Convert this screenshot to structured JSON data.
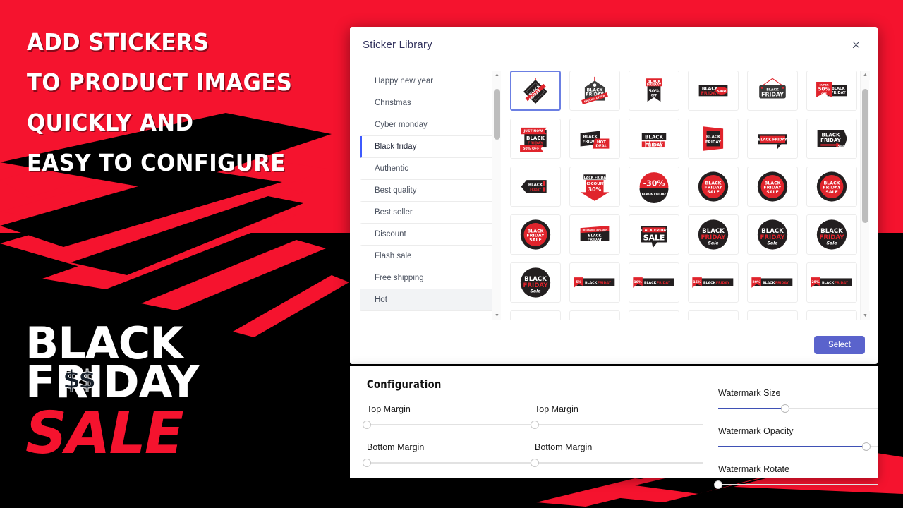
{
  "promo": {
    "headline_lines": [
      "Add Stickers",
      "to product images",
      "Quickly and",
      "Easy to configure"
    ],
    "logo": {
      "line1": "Black",
      "line2": "Friday",
      "dollars": "$$",
      "line3": "Sale"
    },
    "colors": {
      "red": "#f5132e",
      "black": "#000000",
      "white": "#ffffff"
    }
  },
  "modal": {
    "title": "Sticker Library",
    "close_icon": "close-icon",
    "categories": [
      {
        "label": "Happy new year",
        "state": "normal"
      },
      {
        "label": "Christmas",
        "state": "normal"
      },
      {
        "label": "Cyber monday",
        "state": "normal"
      },
      {
        "label": "Black friday",
        "state": "selected"
      },
      {
        "label": "Authentic",
        "state": "normal"
      },
      {
        "label": "Best quality",
        "state": "normal"
      },
      {
        "label": "Best seller",
        "state": "normal"
      },
      {
        "label": "Discount",
        "state": "normal"
      },
      {
        "label": "Flash sale",
        "state": "normal"
      },
      {
        "label": "Free shipping",
        "state": "normal"
      },
      {
        "label": "Hot",
        "state": "hovered"
      }
    ],
    "category_scrollbar": {
      "up_icon": "chevron-up-icon",
      "down_icon": "chevron-down-icon",
      "thumb_top_pct": 4,
      "thumb_height_pct": 22
    },
    "grid_scrollbar": {
      "up_icon": "chevron-up-icon",
      "down_icon": "chevron-down-icon",
      "thumb_top_pct": 4,
      "thumb_height_pct": 58
    },
    "stickers": [
      {
        "id": "s1",
        "type": "diamond-tag",
        "text": "BLACK FRIDAY",
        "sub": "SALE",
        "selected": true
      },
      {
        "id": "s2",
        "type": "price-tag",
        "text": "BLACK FRIDAY",
        "sub": "SPECIAL OFFER",
        "selected": false
      },
      {
        "id": "s3",
        "type": "ribbon-banner",
        "text": "BLACK FRIDAY",
        "sub": "50% OFF",
        "selected": false
      },
      {
        "id": "s4",
        "type": "bar-script",
        "text": "BLACK FRIDAY",
        "sub": "Sale",
        "selected": false
      },
      {
        "id": "s5",
        "type": "hanging-sign",
        "text": "BLACK FRIDAY",
        "sub": "",
        "selected": false
      },
      {
        "id": "s6",
        "type": "corner-percent",
        "text": "BLACK FRIDAY",
        "sub": "SUPER 50% OFF",
        "selected": false
      },
      {
        "id": "s7",
        "type": "justnow-banner",
        "text": "BLACK FRIDAY",
        "sub": "JUST NOW / 50% OFF",
        "selected": false
      },
      {
        "id": "s8",
        "type": "hot-deal",
        "text": "BLACK FRIDAY",
        "sub": "HOT DEAL",
        "selected": false
      },
      {
        "id": "s9",
        "type": "blocks-label",
        "text": "BLACK FRIDAY",
        "sub": "",
        "selected": false
      },
      {
        "id": "s10",
        "type": "folded-ribbon",
        "text": "BLACK FRIDAY",
        "sub": "",
        "selected": false
      },
      {
        "id": "s11",
        "type": "speech-bar",
        "text": "BLACK FRIDAY",
        "sub": "",
        "selected": false
      },
      {
        "id": "s12",
        "type": "arrow-tag",
        "text": "BLACK FRIDAY",
        "sub": "Sale!",
        "selected": false
      },
      {
        "id": "s13",
        "type": "left-arrow-tag",
        "text": "BLACK FRIDAY",
        "sub": "",
        "selected": false
      },
      {
        "id": "s14",
        "type": "down-arrow",
        "text": "BLACK FRIDAY",
        "sub": "DISCOUNT 30%",
        "selected": false
      },
      {
        "id": "s15",
        "type": "circle-percent",
        "text": "-30%",
        "sub": "BLACK FRIDAY",
        "selected": false
      },
      {
        "id": "s16",
        "type": "circle-red-1",
        "text": "BLACK FRIDAY SALE",
        "sub": "",
        "selected": false
      },
      {
        "id": "s17",
        "type": "circle-red-2",
        "text": "BLACK FRIDAY SALE",
        "sub": "",
        "selected": false
      },
      {
        "id": "s18",
        "type": "circle-red-3",
        "text": "BLACK FRIDAY SALE",
        "sub": "",
        "selected": false
      },
      {
        "id": "s19",
        "type": "circle-red-4",
        "text": "BLACK FRIDAY SALE",
        "sub": "",
        "selected": false
      },
      {
        "id": "s20",
        "type": "skew-label",
        "text": "BLACK FRIDAY",
        "sub": "DISCOUNT 30% OFF",
        "selected": false
      },
      {
        "id": "s21",
        "type": "speech-sale",
        "text": "BLACK FRIDAY",
        "sub": "SALE",
        "selected": false
      },
      {
        "id": "s22",
        "type": "circle-black-1",
        "text": "BLACK FRIDAY",
        "sub": "Sale",
        "selected": false
      },
      {
        "id": "s23",
        "type": "circle-black-2",
        "text": "BLACK FRIDAY",
        "sub": "Sale",
        "selected": false
      },
      {
        "id": "s24",
        "type": "circle-black-3",
        "text": "BLACK FRIDAY",
        "sub": "Sale",
        "selected": false
      },
      {
        "id": "s25",
        "type": "circle-black-4",
        "text": "BLACK FRIDAY",
        "sub": "Sale",
        "selected": false
      },
      {
        "id": "s26",
        "type": "percent-bar",
        "text": "BLACK FRIDAY",
        "sub": "5%",
        "selected": false
      },
      {
        "id": "s27",
        "type": "percent-bar",
        "text": "BLACK FRIDAY",
        "sub": "10%",
        "selected": false
      },
      {
        "id": "s28",
        "type": "percent-bar",
        "text": "BLACK FRIDAY",
        "sub": "15%",
        "selected": false
      },
      {
        "id": "s29",
        "type": "percent-bar",
        "text": "BLACK FRIDAY",
        "sub": "20%",
        "selected": false
      },
      {
        "id": "s30",
        "type": "percent-bar",
        "text": "BLACK FRIDAY",
        "sub": "25%",
        "selected": false
      },
      {
        "id": "s31",
        "type": "partial",
        "text": "",
        "sub": "",
        "selected": false
      },
      {
        "id": "s32",
        "type": "partial",
        "text": "",
        "sub": "",
        "selected": false
      },
      {
        "id": "s33",
        "type": "partial",
        "text": "",
        "sub": "",
        "selected": false
      },
      {
        "id": "s34",
        "type": "partial",
        "text": "",
        "sub": "",
        "selected": false
      },
      {
        "id": "s35",
        "type": "partial",
        "text": "",
        "sub": "",
        "selected": false
      },
      {
        "id": "s36",
        "type": "partial-red",
        "text": "",
        "sub": "",
        "selected": false
      }
    ],
    "select_label": "Select",
    "select_color": "#5a63cc"
  },
  "config": {
    "title": "Configuration",
    "columns": [
      {
        "fields": [
          {
            "label": "Top Margin",
            "value": 0
          },
          {
            "label": "Bottom Margin",
            "value": 0
          }
        ]
      },
      {
        "fields": [
          {
            "label": "Top Margin",
            "value": 0
          },
          {
            "label": "Bottom Margin",
            "value": 0
          }
        ]
      },
      {
        "fields": [
          {
            "label": "Watermark Size",
            "value": 42
          },
          {
            "label": "Watermark Opacity",
            "value": 93
          },
          {
            "label": "Watermark Rotate",
            "value": 0
          }
        ]
      }
    ]
  }
}
